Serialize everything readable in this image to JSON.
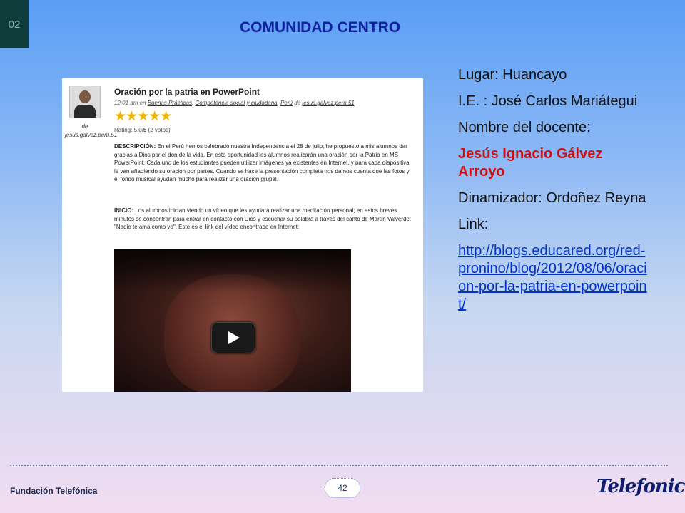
{
  "slide": {
    "number": "02",
    "title": "COMUNIDAD CENTRO",
    "page": "42",
    "footer": "Fundación Telefónica",
    "logo": "Telefonica"
  },
  "blog": {
    "author": "de jesus.galvez.peru.51",
    "post_title": "Oración por la patria en PowerPoint",
    "meta_time": "12:01 am en",
    "meta_cat1": "Buenas Prácticas",
    "meta_cat2": "Competencia social y ciudadana",
    "meta_cat3": "Perú",
    "meta_by": "de",
    "meta_user": "jesus.galvez.peru.51",
    "stars": "★★★★★",
    "rating_label": "Rating: 5.0/",
    "rating_max": "5",
    "rating_votes": " (2 votos)",
    "desc_label": "DESCRIPCIÓN:",
    "desc_text": " En el Perú hemos celebrado nuestra Independencia el 28 de julio; he propuesto a mis alumnos dar gracias a Dios por el don de la vida. En esta oportunidad los alumnos realizarán una oración por la Patria en MS PowerPoint. Cada uno de los estudiantes pueden utilizar imágenes ya existentes en Internet, y para cada diapositiva le van añadiendo su oración por partes. Cuando se hace la presentación completa nos damos cuenta que las fotos y el fondo musical ayudan mucho para realizar una oración grupal.",
    "inicio_label": "INICIO:",
    "inicio_text": " Los alumnos inician viendo un vídeo que les ayudará realizar una meditación personal; en estos breves minutos se concentran para entrar en contacto con Dios y escuchar su palabra a través del canto de Martín Valverde: \"Nadie te ama como yo\". Este es el  link del vídeo encontrado en Internet:"
  },
  "info": {
    "lugar": "Lugar: Huancayo",
    "ie": "I.E. : José Carlos Mariátegui",
    "docente_label": "Nombre del docente:",
    "docente_name": "Jesús Ignacio Gálvez Arroyo",
    "dinamizador": "Dinamizador: Ordoñez Reyna",
    "link_label": "Link:",
    "link_url": "http://blogs.educared.org/red-pronino/blog/2012/08/06/oracion-por-la-patria-en-powerpoint/"
  },
  "colors": {
    "title": "#1020a0",
    "highlight": "#d01010",
    "link": "#0033cc"
  }
}
